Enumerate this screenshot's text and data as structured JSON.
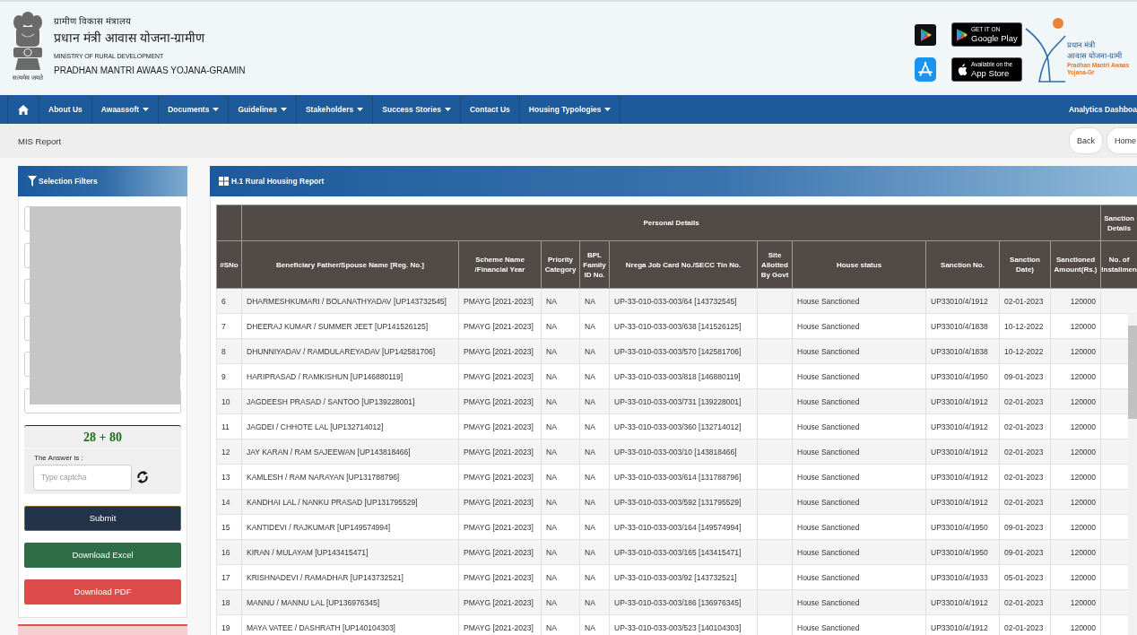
{
  "header": {
    "emblem_motto": "सत्यमेव जयते",
    "ministry_hindi": "ग्रामीण विकास मंत्रालय",
    "scheme_hindi": "प्रधान मंत्री आवास योजना-ग्रामीण",
    "ministry": "MINISTRY OF RURAL DEVELOPMENT",
    "scheme": "PRADHAN MANTRI AWAAS YOJANA-GRAMIN",
    "store_badges": [
      {
        "kind": "google_play",
        "small_text": "GET IT ON",
        "store_name": "Google Play"
      },
      {
        "kind": "app_store",
        "small_text": "Available on the",
        "store_name": "App Store"
      }
    ],
    "logo": {
      "title": "प्रधान मंत्री",
      "subtitle": "आवास योजना-ग्रामी",
      "caption": "Pradhan Mantri Awaas Yojana-Gr"
    }
  },
  "nav": {
    "items": [
      {
        "kind": "home"
      },
      {
        "kind": "link",
        "label": "About Us",
        "dropdown": false
      },
      {
        "kind": "link",
        "label": "Awaassoft",
        "dropdown": true
      },
      {
        "kind": "link",
        "label": "Documents",
        "dropdown": true
      },
      {
        "kind": "link",
        "label": "Guidelines",
        "dropdown": true
      },
      {
        "kind": "link",
        "label": "Stakeholders",
        "dropdown": true
      },
      {
        "kind": "link",
        "label": "Success Stories",
        "dropdown": true
      },
      {
        "kind": "link",
        "label": "Contact Us",
        "dropdown": false
      },
      {
        "kind": "link",
        "label": "Housing Typologies",
        "dropdown": true
      }
    ],
    "right_link": "Analytics Dashboa"
  },
  "breadcrumb": {
    "title": "MIS Report",
    "buttons": [
      "Back",
      "Home"
    ]
  },
  "filters": {
    "title": "Selection Filters",
    "fields": [
      {
        "kind": "dropdown"
      },
      {
        "kind": "dropdown"
      },
      {
        "kind": "dropdown"
      },
      {
        "kind": "dropdown"
      },
      {
        "kind": "dropdown"
      },
      {
        "kind": "dropdown"
      }
    ],
    "redacted": true,
    "captcha": {
      "question": "28 + 80",
      "answer_label": "The Answer is :",
      "placeholder": "Type captcha"
    },
    "buttons": [
      {
        "kind": "submit",
        "label": "Submit"
      },
      {
        "kind": "excel",
        "label": "Download Excel"
      },
      {
        "kind": "pdf",
        "label": "Download PDF"
      }
    ]
  },
  "report": {
    "title": "H.1 Rural Housing Report",
    "header_groups": [
      {
        "columns": [
          {
            "label": "#SNo",
            "kind": "text"
          }
        ]
      },
      {
        "label": "Personal Details",
        "columns": [
          {
            "label": "Beneficiary Father/Spouse Name [Reg. No.]",
            "kind": "text"
          },
          {
            "label": "Scheme Name /Financial Year",
            "kind": "text"
          },
          {
            "label": "Priority Category",
            "kind": "text"
          },
          {
            "label": "BPL Family ID No.",
            "kind": "text"
          },
          {
            "label": "Nrega Job Card No./SECC Tin No.",
            "kind": "text"
          },
          {
            "label": "Site Allotted By Govt",
            "kind": "text"
          },
          {
            "label": "House status",
            "kind": "text"
          },
          {
            "label": "Sanction No.",
            "kind": "text"
          },
          {
            "label": "Sanction Date)",
            "kind": "text"
          },
          {
            "label": "Sanctioned Amount(Rs.)",
            "kind": "amount"
          }
        ]
      },
      {
        "label": "Sanction Details",
        "columns": [
          {
            "label": "No. of Installmen",
            "kind": "text"
          }
        ]
      }
    ],
    "rows": [
      [
        "6",
        "DHARMESHKUMARI / BOLANATHYADAV [UP143732545]",
        "PMAYG [2021-2023]",
        "NA",
        "NA",
        "UP-33-010-033-003/64 [143732545]",
        null,
        "House Sanctioned",
        "UP33010/4/1912",
        "02-01-2023",
        "120000",
        null
      ],
      [
        "7",
        "DHEERAJ KUMAR / SUMMER JEET [UP141526125]",
        "PMAYG [2021-2023]",
        "NA",
        "NA",
        "UP-33-010-033-003/638 [141526125]",
        null,
        "House Sanctioned",
        "UP33010/4/1838",
        "10-12-2022",
        "120000",
        null
      ],
      [
        "8",
        "DHUNNIYADAV / RAMDULAREYADAV [UP142581706]",
        "PMAYG [2021-2023]",
        "NA",
        "NA",
        "UP-33-010-033-003/570 [142581706]",
        null,
        "House Sanctioned",
        "UP33010/4/1838",
        "10-12-2022",
        "120000",
        null
      ],
      [
        "9",
        "HARIPRASAD / RAMKISHUN [UP146880119]",
        "PMAYG [2021-2023]",
        "NA",
        "NA",
        "UP-33-010-033-003/818 [146880119]",
        null,
        "House Sanctioned",
        "UP33010/4/1950",
        "09-01-2023",
        "120000",
        null
      ],
      [
        "10",
        "JAGDEESH PRASAD / SANTOO [UP139228001]",
        "PMAYG [2021-2023]",
        "NA",
        "NA",
        "UP-33-010-033-003/731 [139228001]",
        null,
        "House Sanctioned",
        "UP33010/4/1912",
        "02-01-2023",
        "120000",
        null
      ],
      [
        "11",
        "JAGDEI / CHHOTE LAL [UP132714012]",
        "PMAYG [2021-2023]",
        "NA",
        "NA",
        "UP-33-010-033-003/360 [132714012]",
        null,
        "House Sanctioned",
        "UP33010/4/1912",
        "02-01-2023",
        "120000",
        null
      ],
      [
        "12",
        "JAY KARAN / RAM SAJEEWAN [UP143818466]",
        "PMAYG [2021-2023]",
        "NA",
        "NA",
        "UP-33-010-033-003/10 [143818466]",
        null,
        "House Sanctioned",
        "UP33010/4/1912",
        "02-01-2023",
        "120000",
        null
      ],
      [
        "13",
        "KAMLESH / RAM NARAYAN [UP131788796]",
        "PMAYG [2021-2023]",
        "NA",
        "NA",
        "UP-33-010-033-003/614 [131788796]",
        null,
        "House Sanctioned",
        "UP33010/4/1912",
        "02-01-2023",
        "120000",
        null
      ],
      [
        "14",
        "KANDHAI LAL / NANKU PRASAD [UP131795529]",
        "PMAYG [2021-2023]",
        "NA",
        "NA",
        "UP-33-010-033-003/592 [131795529]",
        null,
        "House Sanctioned",
        "UP33010/4/1912",
        "02-01-2023",
        "120000",
        null
      ],
      [
        "15",
        "KANTIDEVI / RAJKUMAR [UP149574994]",
        "PMAYG [2021-2023]",
        "NA",
        "NA",
        "UP-33-010-033-003/164 [149574994]",
        null,
        "House Sanctioned",
        "UP33010/4/1950",
        "09-01-2023",
        "120000",
        null
      ],
      [
        "16",
        "KIRAN / MULAYAM [UP143415471]",
        "PMAYG [2021-2023]",
        "NA",
        "NA",
        "UP-33-010-033-003/165 [143415471]",
        null,
        "House Sanctioned",
        "UP33010/4/1950",
        "09-01-2023",
        "120000",
        null
      ],
      [
        "17",
        "KRISHNADEVI / RAMADHAR [UP143732521]",
        "PMAYG [2021-2023]",
        "NA",
        "NA",
        "UP-33-010-033-003/92 [143732521]",
        null,
        "House Sanctioned",
        "UP33010/4/1933",
        "05-01-2023",
        "120000",
        null
      ],
      [
        "18",
        "MANNU / MANNU LAL [UP136976345]",
        "PMAYG [2021-2023]",
        "NA",
        "NA",
        "UP-33-010-033-003/186 [136976345]",
        null,
        "House Sanctioned",
        "UP33010/4/1912",
        "02-01-2023",
        "120000",
        null
      ],
      [
        "19",
        "MAYA VATEE / DASHRATH [UP140104303]",
        "PMAYG [2021-2023]",
        "NA",
        "NA",
        "UP-33-010-033-003/523 [140104303]",
        null,
        "House Sanctioned",
        "UP33010/4/1912",
        "02-01-2023",
        "120000",
        null
      ]
    ]
  }
}
